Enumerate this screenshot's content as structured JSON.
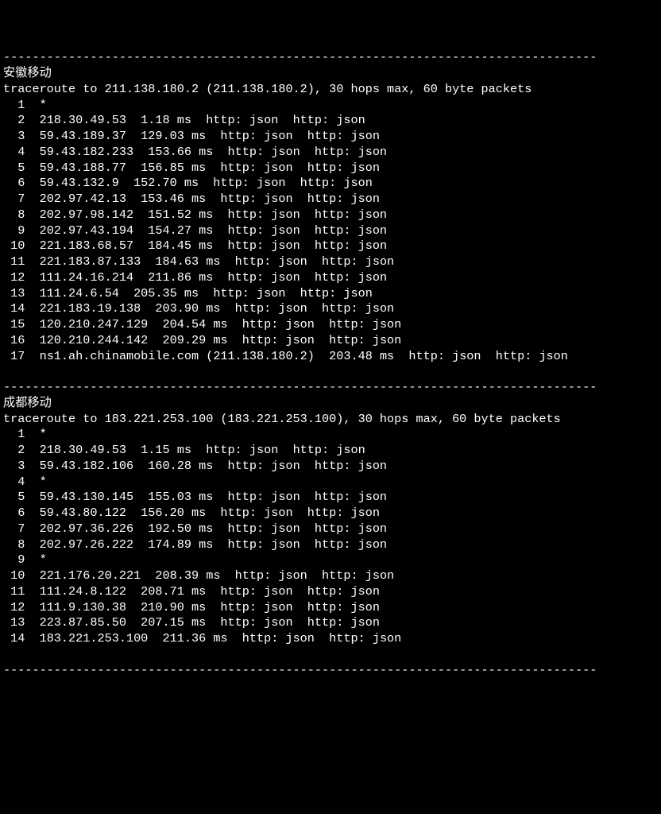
{
  "divider": "----------------------------------------------------------------------------------",
  "sections": [
    {
      "title": "安徽移动",
      "header": "traceroute to 211.138.180.2 (211.138.180.2), 30 hops max, 60 byte packets",
      "hops": [
        {
          "n": 1,
          "star": true
        },
        {
          "n": 2,
          "ip": "218.30.49.53",
          "ms": "1.18 ms",
          "tail": "http: json  http: json"
        },
        {
          "n": 3,
          "ip": "59.43.189.37",
          "ms": "129.03 ms",
          "tail": "http: json  http: json"
        },
        {
          "n": 4,
          "ip": "59.43.182.233",
          "ms": "153.66 ms",
          "tail": "http: json  http: json"
        },
        {
          "n": 5,
          "ip": "59.43.188.77",
          "ms": "156.85 ms",
          "tail": "http: json  http: json"
        },
        {
          "n": 6,
          "ip": "59.43.132.9",
          "ms": "152.70 ms",
          "tail": "http: json  http: json"
        },
        {
          "n": 7,
          "ip": "202.97.42.13",
          "ms": "153.46 ms",
          "tail": "http: json  http: json"
        },
        {
          "n": 8,
          "ip": "202.97.98.142",
          "ms": "151.52 ms",
          "tail": "http: json  http: json"
        },
        {
          "n": 9,
          "ip": "202.97.43.194",
          "ms": "154.27 ms",
          "tail": "http: json  http: json"
        },
        {
          "n": 10,
          "ip": "221.183.68.57",
          "ms": "184.45 ms",
          "tail": "http: json  http: json"
        },
        {
          "n": 11,
          "ip": "221.183.87.133",
          "ms": "184.63 ms",
          "tail": "http: json  http: json"
        },
        {
          "n": 12,
          "ip": "111.24.16.214",
          "ms": "211.86 ms",
          "tail": "http: json  http: json"
        },
        {
          "n": 13,
          "ip": "111.24.6.54",
          "ms": "205.35 ms",
          "tail": "http: json  http: json"
        },
        {
          "n": 14,
          "ip": "221.183.19.138",
          "ms": "203.90 ms",
          "tail": "http: json  http: json"
        },
        {
          "n": 15,
          "ip": "120.210.247.129",
          "ms": "204.54 ms",
          "tail": "http: json  http: json"
        },
        {
          "n": 16,
          "ip": "120.210.244.142",
          "ms": "209.29 ms",
          "tail": "http: json  http: json"
        },
        {
          "n": 17,
          "ip": "ns1.ah.chinamobile.com (211.138.180.2)",
          "ms": "203.48 ms",
          "tail": "http: json  http: json"
        }
      ]
    },
    {
      "title": "成都移动",
      "header": "traceroute to 183.221.253.100 (183.221.253.100), 30 hops max, 60 byte packets",
      "hops": [
        {
          "n": 1,
          "star": true
        },
        {
          "n": 2,
          "ip": "218.30.49.53",
          "ms": "1.15 ms",
          "tail": "http: json  http: json"
        },
        {
          "n": 3,
          "ip": "59.43.182.106",
          "ms": "160.28 ms",
          "tail": "http: json  http: json"
        },
        {
          "n": 4,
          "star": true
        },
        {
          "n": 5,
          "ip": "59.43.130.145",
          "ms": "155.03 ms",
          "tail": "http: json  http: json"
        },
        {
          "n": 6,
          "ip": "59.43.80.122",
          "ms": "156.20 ms",
          "tail": "http: json  http: json"
        },
        {
          "n": 7,
          "ip": "202.97.36.226",
          "ms": "192.50 ms",
          "tail": "http: json  http: json"
        },
        {
          "n": 8,
          "ip": "202.97.26.222",
          "ms": "174.89 ms",
          "tail": "http: json  http: json"
        },
        {
          "n": 9,
          "star": true
        },
        {
          "n": 10,
          "ip": "221.176.20.221",
          "ms": "208.39 ms",
          "tail": "http: json  http: json"
        },
        {
          "n": 11,
          "ip": "111.24.8.122",
          "ms": "208.71 ms",
          "tail": "http: json  http: json"
        },
        {
          "n": 12,
          "ip": "111.9.130.38",
          "ms": "210.90 ms",
          "tail": "http: json  http: json"
        },
        {
          "n": 13,
          "ip": "223.87.85.50",
          "ms": "207.15 ms",
          "tail": "http: json  http: json"
        },
        {
          "n": 14,
          "ip": "183.221.253.100",
          "ms": "211.36 ms",
          "tail": "http: json  http: json"
        }
      ]
    }
  ]
}
